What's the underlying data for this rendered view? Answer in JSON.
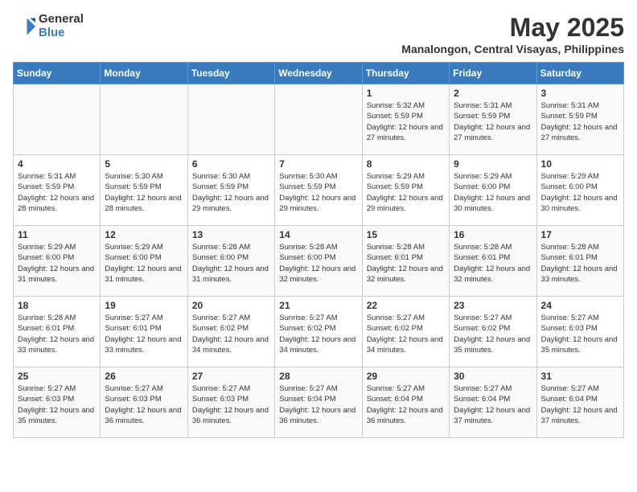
{
  "logo": {
    "general": "General",
    "blue": "Blue"
  },
  "title": "May 2025",
  "subtitle": "Manalongon, Central Visayas, Philippines",
  "days_of_week": [
    "Sunday",
    "Monday",
    "Tuesday",
    "Wednesday",
    "Thursday",
    "Friday",
    "Saturday"
  ],
  "weeks": [
    [
      {
        "day": "",
        "info": ""
      },
      {
        "day": "",
        "info": ""
      },
      {
        "day": "",
        "info": ""
      },
      {
        "day": "",
        "info": ""
      },
      {
        "day": "1",
        "info": "Sunrise: 5:32 AM\nSunset: 5:59 PM\nDaylight: 12 hours and 27 minutes."
      },
      {
        "day": "2",
        "info": "Sunrise: 5:31 AM\nSunset: 5:59 PM\nDaylight: 12 hours and 27 minutes."
      },
      {
        "day": "3",
        "info": "Sunrise: 5:31 AM\nSunset: 5:59 PM\nDaylight: 12 hours and 27 minutes."
      }
    ],
    [
      {
        "day": "4",
        "info": "Sunrise: 5:31 AM\nSunset: 5:59 PM\nDaylight: 12 hours and 28 minutes."
      },
      {
        "day": "5",
        "info": "Sunrise: 5:30 AM\nSunset: 5:59 PM\nDaylight: 12 hours and 28 minutes."
      },
      {
        "day": "6",
        "info": "Sunrise: 5:30 AM\nSunset: 5:59 PM\nDaylight: 12 hours and 29 minutes."
      },
      {
        "day": "7",
        "info": "Sunrise: 5:30 AM\nSunset: 5:59 PM\nDaylight: 12 hours and 29 minutes."
      },
      {
        "day": "8",
        "info": "Sunrise: 5:29 AM\nSunset: 5:59 PM\nDaylight: 12 hours and 29 minutes."
      },
      {
        "day": "9",
        "info": "Sunrise: 5:29 AM\nSunset: 6:00 PM\nDaylight: 12 hours and 30 minutes."
      },
      {
        "day": "10",
        "info": "Sunrise: 5:29 AM\nSunset: 6:00 PM\nDaylight: 12 hours and 30 minutes."
      }
    ],
    [
      {
        "day": "11",
        "info": "Sunrise: 5:29 AM\nSunset: 6:00 PM\nDaylight: 12 hours and 31 minutes."
      },
      {
        "day": "12",
        "info": "Sunrise: 5:29 AM\nSunset: 6:00 PM\nDaylight: 12 hours and 31 minutes."
      },
      {
        "day": "13",
        "info": "Sunrise: 5:28 AM\nSunset: 6:00 PM\nDaylight: 12 hours and 31 minutes."
      },
      {
        "day": "14",
        "info": "Sunrise: 5:28 AM\nSunset: 6:00 PM\nDaylight: 12 hours and 32 minutes."
      },
      {
        "day": "15",
        "info": "Sunrise: 5:28 AM\nSunset: 6:01 PM\nDaylight: 12 hours and 32 minutes."
      },
      {
        "day": "16",
        "info": "Sunrise: 5:28 AM\nSunset: 6:01 PM\nDaylight: 12 hours and 32 minutes."
      },
      {
        "day": "17",
        "info": "Sunrise: 5:28 AM\nSunset: 6:01 PM\nDaylight: 12 hours and 33 minutes."
      }
    ],
    [
      {
        "day": "18",
        "info": "Sunrise: 5:28 AM\nSunset: 6:01 PM\nDaylight: 12 hours and 33 minutes."
      },
      {
        "day": "19",
        "info": "Sunrise: 5:27 AM\nSunset: 6:01 PM\nDaylight: 12 hours and 33 minutes."
      },
      {
        "day": "20",
        "info": "Sunrise: 5:27 AM\nSunset: 6:02 PM\nDaylight: 12 hours and 34 minutes."
      },
      {
        "day": "21",
        "info": "Sunrise: 5:27 AM\nSunset: 6:02 PM\nDaylight: 12 hours and 34 minutes."
      },
      {
        "day": "22",
        "info": "Sunrise: 5:27 AM\nSunset: 6:02 PM\nDaylight: 12 hours and 34 minutes."
      },
      {
        "day": "23",
        "info": "Sunrise: 5:27 AM\nSunset: 6:02 PM\nDaylight: 12 hours and 35 minutes."
      },
      {
        "day": "24",
        "info": "Sunrise: 5:27 AM\nSunset: 6:03 PM\nDaylight: 12 hours and 35 minutes."
      }
    ],
    [
      {
        "day": "25",
        "info": "Sunrise: 5:27 AM\nSunset: 6:03 PM\nDaylight: 12 hours and 35 minutes."
      },
      {
        "day": "26",
        "info": "Sunrise: 5:27 AM\nSunset: 6:03 PM\nDaylight: 12 hours and 36 minutes."
      },
      {
        "day": "27",
        "info": "Sunrise: 5:27 AM\nSunset: 6:03 PM\nDaylight: 12 hours and 36 minutes."
      },
      {
        "day": "28",
        "info": "Sunrise: 5:27 AM\nSunset: 6:04 PM\nDaylight: 12 hours and 36 minutes."
      },
      {
        "day": "29",
        "info": "Sunrise: 5:27 AM\nSunset: 6:04 PM\nDaylight: 12 hours and 36 minutes."
      },
      {
        "day": "30",
        "info": "Sunrise: 5:27 AM\nSunset: 6:04 PM\nDaylight: 12 hours and 37 minutes."
      },
      {
        "day": "31",
        "info": "Sunrise: 5:27 AM\nSunset: 6:04 PM\nDaylight: 12 hours and 37 minutes."
      }
    ]
  ]
}
